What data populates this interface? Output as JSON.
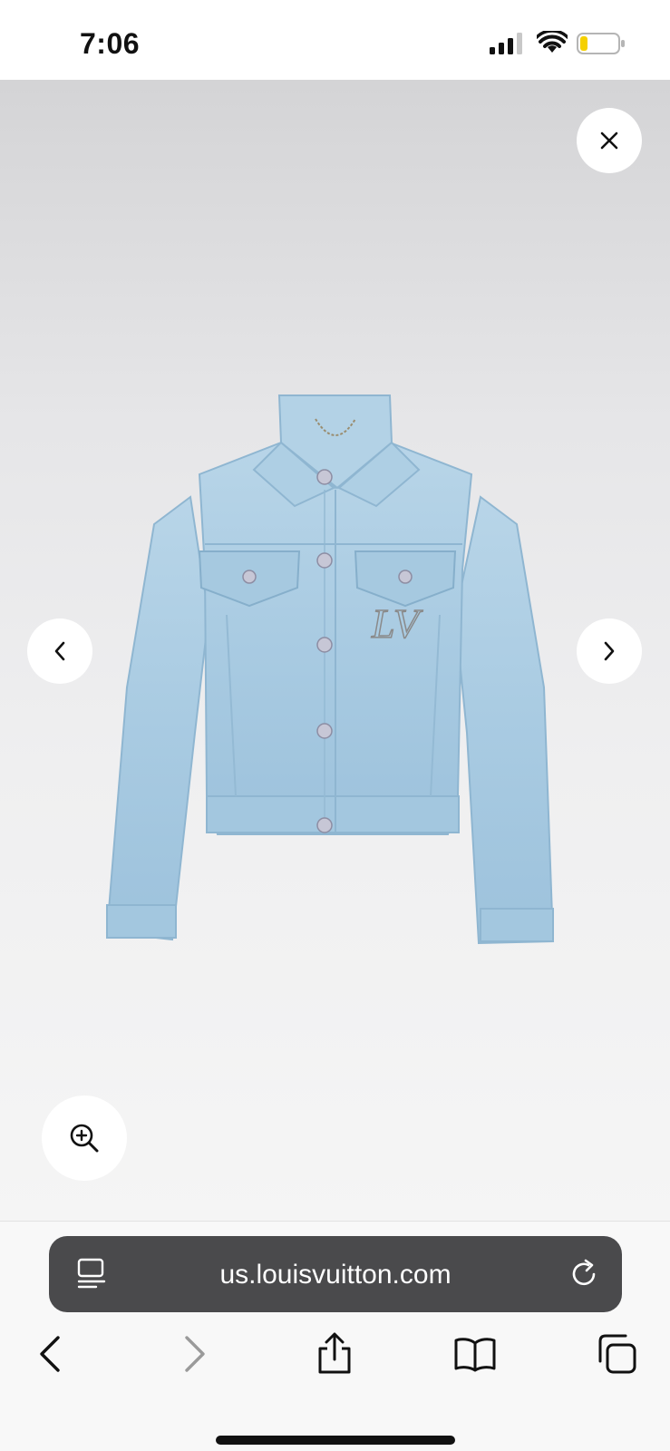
{
  "status_bar": {
    "time": "7:06"
  },
  "browser": {
    "url": "us.louisvuitton.com"
  },
  "colors": {
    "url_bar_bg": "#4a4a4c",
    "denim": "#a9cbe2",
    "battery_level_color": "#f5d000"
  },
  "icons": {
    "close": "close-icon",
    "previous": "chevron-left-icon",
    "next": "chevron-right-icon",
    "zoom": "zoom-in-icon",
    "reader": "reader-icon",
    "reload": "reload-icon",
    "back": "back-arrow-icon",
    "forward": "forward-arrow-icon",
    "share": "share-icon",
    "bookmarks": "bookmarks-icon",
    "tabs": "tabs-icon"
  },
  "battery_level": 0.2
}
